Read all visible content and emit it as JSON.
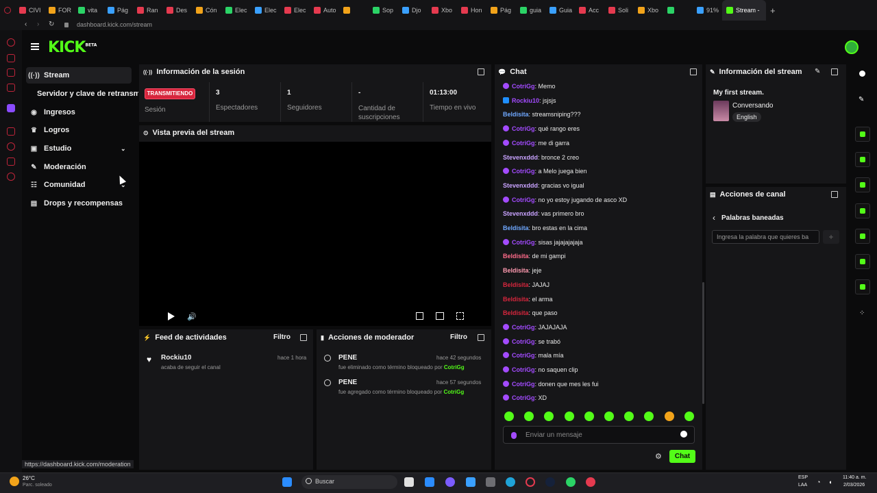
{
  "browser": {
    "tabs": [
      "CIVI",
      "FOR",
      "vita",
      "Pág",
      "Ran",
      "Des",
      "Cón",
      "Elec",
      "Elec",
      "Elec",
      "Auto",
      "",
      "Sop",
      "Djo",
      "Xbo",
      "Hon",
      "Pág",
      "guia",
      "Guia",
      "Acc",
      "Soli",
      "Xbo",
      "",
      "91%",
      "Stream -"
    ],
    "active_tab": "Stream -",
    "url": "dashboard.kick.com/stream",
    "status_url": "https://dashboard.kick.com/moderation"
  },
  "kick": {
    "logo": "KICK",
    "logo_beta": "BETA"
  },
  "nav": {
    "items": [
      {
        "label": "Stream",
        "icon": "broadcast-icon"
      },
      {
        "label": "Servidor y clave de retransm",
        "icon": ""
      },
      {
        "label": "Ingresos",
        "icon": "coins-icon"
      },
      {
        "label": "Logros",
        "icon": "trophy-icon"
      },
      {
        "label": "Estudio",
        "icon": "studio-icon"
      },
      {
        "label": "Moderación",
        "icon": "wrench-icon"
      },
      {
        "label": "Comunidad",
        "icon": "community-icon"
      },
      {
        "label": "Drops y recompensas",
        "icon": "gift-icon"
      }
    ]
  },
  "session": {
    "title": "Información de la sesión",
    "live_badge": "TRANSMITIENDO",
    "session_label": "Sesión",
    "stats": [
      {
        "value": "3",
        "label": "Espectadores"
      },
      {
        "value": "1",
        "label": "Seguidores"
      },
      {
        "value": "-",
        "label": "Cantidad de suscripciones"
      },
      {
        "value": "01:13:00",
        "label": "Tiempo en vivo"
      }
    ]
  },
  "preview": {
    "title": "Vista previa del stream"
  },
  "activity": {
    "title": "Feed de actividades",
    "filter": "Filtro",
    "items": [
      {
        "user": "Rockiu10",
        "time": "hace 1 hora",
        "text": "acaba de seguir el canal"
      }
    ]
  },
  "modactions": {
    "title": "Acciones de moderador",
    "filter": "Filtro",
    "items": [
      {
        "word": "PENE",
        "time": "hace 42 segundos",
        "text": "fue eliminado como término bloqueado por",
        "by": "CotriGg"
      },
      {
        "word": "PENE",
        "time": "hace 57 segundos",
        "text": "fue agregado como término bloqueado por",
        "by": "CotriGg"
      }
    ]
  },
  "chat": {
    "title": "Chat",
    "messages": [
      {
        "user": "CotriGg",
        "color": "#a34bff",
        "badge": "purple",
        "text": ": Memo"
      },
      {
        "user": "Rockiu10",
        "color": "#a34bff",
        "badge": "blue",
        "text": ": jsjsjs"
      },
      {
        "user": "Beldisita",
        "color": "#6fa8ff",
        "badge": "",
        "text": ": streamsniping???"
      },
      {
        "user": "CotriGg",
        "color": "#a34bff",
        "badge": "purple",
        "text": ": qué rango eres"
      },
      {
        "user": "CotriGg",
        "color": "#a34bff",
        "badge": "purple",
        "text": ": me di garra"
      },
      {
        "user": "Stevenxddd",
        "color": "#c9a3ff",
        "badge": "",
        "text": ": bronce 2 creo"
      },
      {
        "user": "CotriGg",
        "color": "#a34bff",
        "badge": "purple",
        "text": ": a Melo juega bien"
      },
      {
        "user": "Stevenxddd",
        "color": "#c9a3ff",
        "badge": "",
        "text": ": gracias vo igual"
      },
      {
        "user": "CotriGg",
        "color": "#a34bff",
        "badge": "purple",
        "text": ": no yo estoy jugando de asco XD"
      },
      {
        "user": "Stevenxddd",
        "color": "#c9a3ff",
        "badge": "",
        "text": ": vas primero bro"
      },
      {
        "user": "Beldisita",
        "color": "#6fa8ff",
        "badge": "",
        "text": ": bro estas en la cima"
      },
      {
        "user": "CotriGg",
        "color": "#a34bff",
        "badge": "purple",
        "text": ": sisas jajajajajaja"
      },
      {
        "user": "Beldisita",
        "color": "#ff6b8a",
        "badge": "",
        "text": ": de mi gampi"
      },
      {
        "user": "Beldisita",
        "color": "#ff9ab0",
        "badge": "",
        "text": ": jeje"
      },
      {
        "user": "Beldisita",
        "color": "#d7263d",
        "badge": "",
        "text": ": JAJAJ"
      },
      {
        "user": "Beldisita",
        "color": "#d7263d",
        "badge": "",
        "text": ": el arma"
      },
      {
        "user": "Beldisita",
        "color": "#d7263d",
        "badge": "",
        "text": ": que paso"
      },
      {
        "user": "CotriGg",
        "color": "#a34bff",
        "badge": "purple",
        "text": ": JAJAJAJA"
      },
      {
        "user": "CotriGg",
        "color": "#a34bff",
        "badge": "purple",
        "text": ": se trabó"
      },
      {
        "user": "CotriGg",
        "color": "#a34bff",
        "badge": "purple",
        "text": ": mala mía"
      },
      {
        "user": "CotriGg",
        "color": "#a34bff",
        "badge": "purple",
        "text": ": no saquen clip"
      },
      {
        "user": "CotriGg",
        "color": "#a34bff",
        "badge": "purple",
        "text": ": donen que mes les fui"
      },
      {
        "user": "CotriGg",
        "color": "#a34bff",
        "badge": "purple",
        "text": ": XD"
      }
    ],
    "input_placeholder": "Enviar un mensaje",
    "send_label": "Chat"
  },
  "streaminfo": {
    "title": "Información del stream",
    "stream_title": "My first stream.",
    "category": "Conversando",
    "language": "English"
  },
  "channel": {
    "title": "Acciones de canal",
    "section": "Palabras baneadas",
    "input_placeholder": "Ingresa la palabra que quieres ba"
  },
  "taskbar": {
    "weather_temp": "26°C",
    "weather_desc": "Parc. soleado",
    "search": "Buscar",
    "lang": "ESP",
    "lang2": "LAA",
    "time": "11:40 a. m.",
    "date": "2/03/2026"
  },
  "colors": {
    "accent": "#53fc18",
    "live": "#d7263d"
  }
}
